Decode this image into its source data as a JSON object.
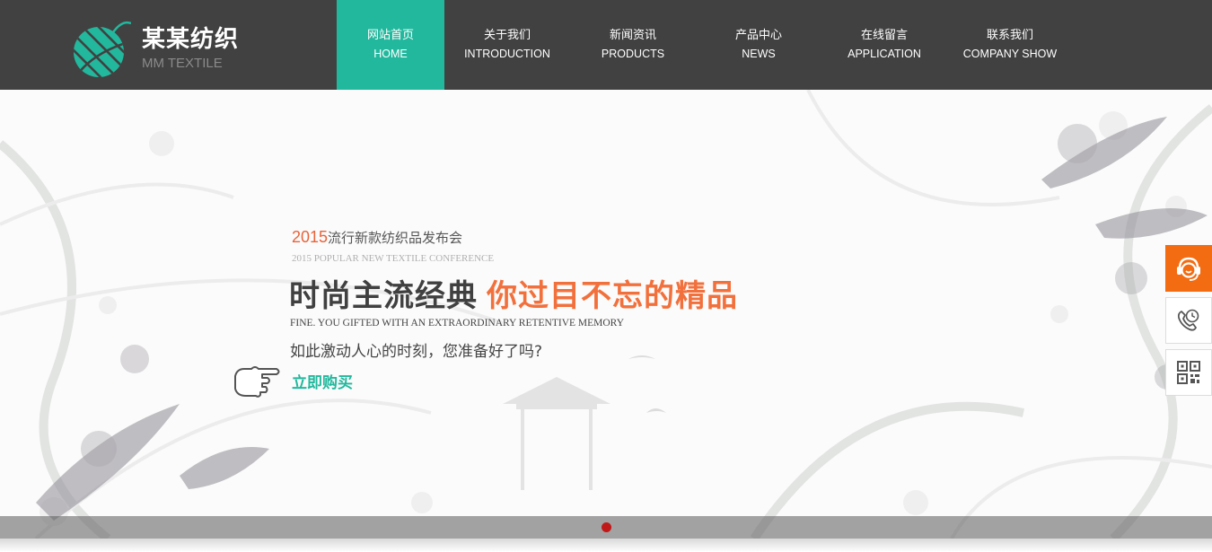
{
  "brand": {
    "name": "某某纺织",
    "sub": "MM TEXTILE",
    "logo_color": "#22b89d"
  },
  "nav": {
    "items": [
      {
        "cn": "网站首页",
        "en": "HOME",
        "active": true
      },
      {
        "cn": "关于我们",
        "en": "INTRODUCTION"
      },
      {
        "cn": "新闻资讯",
        "en": "PRODUCTS"
      },
      {
        "cn": "产品中心",
        "en": "NEWS"
      },
      {
        "cn": "在线留言",
        "en": "APPLICATION"
      },
      {
        "cn": "联系我们",
        "en": "COMPANY SHOW"
      }
    ]
  },
  "banner": {
    "kicker_year": "2015",
    "kicker_text": "流行新款纺织品发布会",
    "kicker_en": "2015 POPULAR NEW TEXTILE CONFERENCE",
    "headline_main": "时尚主流经典",
    "headline_accent": "你过目不忘的精品",
    "tagline_en": "FINE. YOU GIFTED WITH AN EXTRAORDINARY RETENTIVE MEMORY",
    "question": "如此激动人心的时刻，您准备好了吗?",
    "cta": "立即购买",
    "hand_icon": "pointing-hand-icon",
    "active_slide_color": "#c01818"
  },
  "side_bar": {
    "service_icon": "customer-service-icon",
    "phone_icon": "phone-call-icon",
    "qr_icon": "qr-code-icon",
    "service_color": "#f36c12"
  },
  "colors": {
    "header_bg": "#414141",
    "accent_green": "#22b89d",
    "accent_orange": "#f2703c"
  }
}
